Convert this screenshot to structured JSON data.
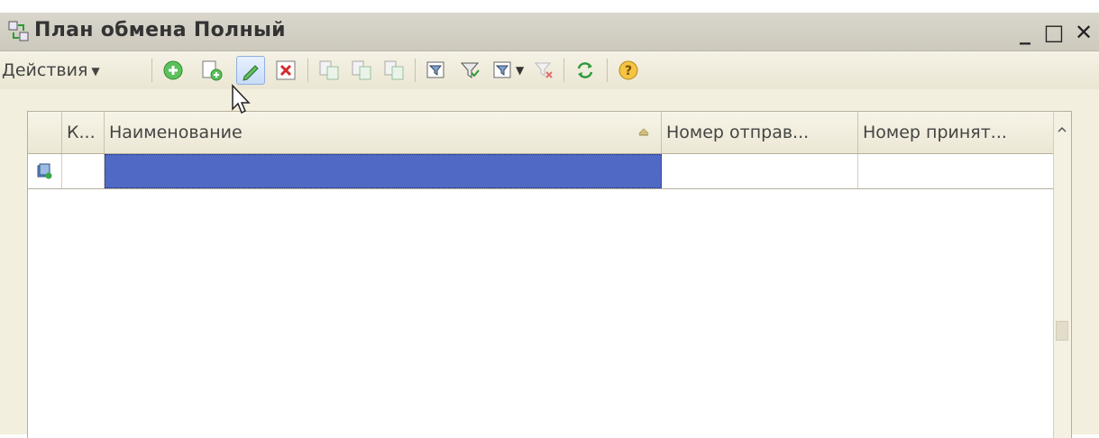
{
  "window": {
    "title": "План обмена Полный",
    "controls": {
      "minimize": "_",
      "maximize": "□",
      "close": "✕"
    }
  },
  "toolbar": {
    "actions_label": "Действия",
    "buttons": [
      "add-icon",
      "copy-icon",
      "edit-icon",
      "delete-icon",
      "move-icon",
      "copy-tree-icon",
      "tree-icon",
      "filter-setup-icon",
      "filter-icon",
      "filter-dropdown-icon",
      "filter-clear-icon",
      "refresh-icon",
      "help-icon"
    ]
  },
  "table": {
    "columns": {
      "code": "К...",
      "name": "Наименование",
      "sent_number": "Номер отправ...",
      "received_number": "Номер принят..."
    },
    "rows": [
      {
        "code": "",
        "name": "",
        "sent_number": "",
        "received_number": ""
      }
    ]
  },
  "colors": {
    "selection": "#4f69c4",
    "panel_bg": "#f3efde",
    "titlebar": "#d4d0c4"
  }
}
